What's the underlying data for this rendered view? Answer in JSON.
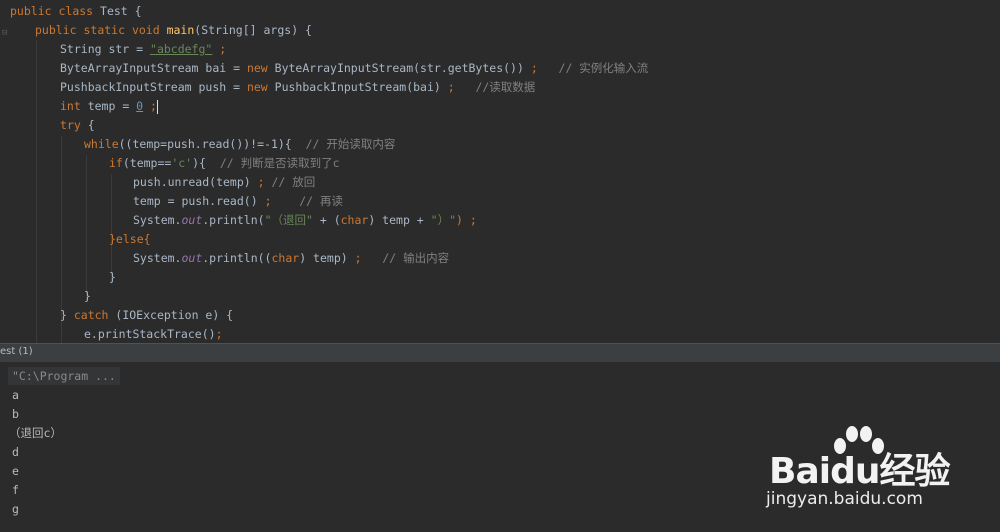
{
  "code": {
    "l1": {
      "a": "public ",
      "b": "class ",
      "c": "Test {"
    },
    "l2": {
      "a": "public ",
      "b": "static ",
      "c": "void ",
      "d": "main",
      "e": "(String[] args) {"
    },
    "l3": {
      "a": "String str = ",
      "b": "\"abcdefg\"",
      "c": " ;"
    },
    "l4": {
      "a": "ByteArrayInputStream bai = ",
      "b": "new ",
      "c": "ByteArrayInputStream(str.getBytes()) ",
      "d": ";",
      "e": "   // 实例化输入流"
    },
    "l5": {
      "a": "PushbackInputStream push = ",
      "b": "new ",
      "c": "PushbackInputStream(bai) ",
      "d": ";",
      "e": "   //读取数据"
    },
    "l6": {
      "a": "int ",
      "b": "temp = ",
      "c": "0",
      "d": " ;"
    },
    "l7": {
      "a": "try ",
      "b": "{"
    },
    "l8": {
      "a": "while",
      "b": "((temp=push.read())!=-1){  ",
      "c": "// 开始读取内容"
    },
    "l9": {
      "a": "if",
      "b": "(temp==",
      "c": "'c'",
      "d": "){  ",
      "e": "// 判断是否读取到了c"
    },
    "l10": {
      "a": "push.unread(temp) ",
      "b": ";",
      "c": " // 放回"
    },
    "l11": {
      "a": "temp = push.read() ",
      "b": ";",
      "c": "    // 再读"
    },
    "l12": {
      "a": "System.",
      "b": "out",
      "c": ".println(",
      "d": "\"（退回\"",
      "e": " + (",
      "f": "char",
      "g": ") temp + ",
      "h": "\"）\"",
      "i": ") ;"
    },
    "l13": {
      "a": "}else{"
    },
    "l14": {
      "a": "System.",
      "b": "out",
      "c": ".println((",
      "d": "char",
      "e": ") temp) ",
      "f": ";",
      "g": "   // 输出内容"
    },
    "l15": {
      "a": "}"
    },
    "l16": {
      "a": "}"
    },
    "l17": {
      "a": "} ",
      "b": "catch ",
      "c": "(IOException e) {"
    },
    "l18": {
      "a": "e.printStackTrace()",
      "b": ";"
    }
  },
  "run_panel": {
    "title": "est (1)",
    "command": "\"C:\\Program ..."
  },
  "console_output": [
    "a",
    "b",
    "（退回c）",
    "d",
    "e",
    "f",
    "g"
  ],
  "watermark": {
    "brand": "Baidu经验",
    "url": "jingyan.baidu.com"
  },
  "colors": {
    "background": "#2b2b2b",
    "keyword": "#cc7832",
    "string": "#6a8759",
    "comment": "#808080",
    "number": "#6897bb",
    "method": "#ffc66d",
    "field": "#9876aa"
  }
}
